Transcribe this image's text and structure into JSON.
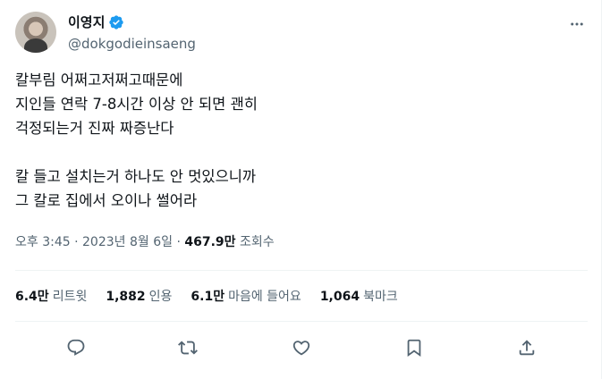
{
  "author": {
    "display_name": "이영지",
    "handle": "@dokgodieinsaeng",
    "verified": true
  },
  "tweet": {
    "text": "칼부림 어쩌고저쩌고때문에\n지인들 연락 7-8시간 이상 안 되면 괜히\n걱정되는거 진짜 짜증난다\n\n칼 들고 설치는거 하나도 안 멋있으니까\n그 칼로 집에서 오이나 썰어라"
  },
  "meta": {
    "time": "오후 3:45",
    "separator1": " · ",
    "date": "2023년 8월 6일",
    "separator2": " · ",
    "views_count": "467.9만",
    "views_label": " 조회수"
  },
  "stats": [
    {
      "count": "6.4만",
      "label": "리트윗"
    },
    {
      "count": "1,882",
      "label": "인용"
    },
    {
      "count": "6.1만",
      "label": "마음에 들어요"
    },
    {
      "count": "1,064",
      "label": "북마크"
    }
  ],
  "actions": [
    "reply-icon",
    "retweet-icon",
    "like-icon",
    "bookmark-icon",
    "share-icon"
  ],
  "colors": {
    "verified": "#1d9bf0",
    "muted": "#536471",
    "text": "#0f1419",
    "divider": "#eff3f4"
  }
}
